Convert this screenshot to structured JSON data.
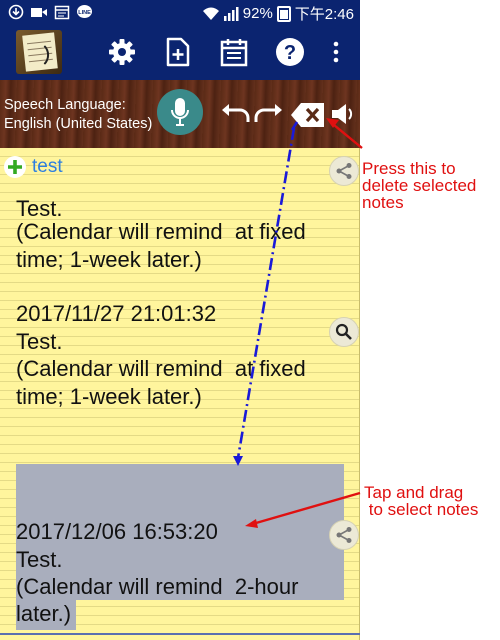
{
  "status_bar": {
    "battery": "92%",
    "time": "下午2:46",
    "icons": [
      "download-icon",
      "video-icon",
      "calendar-icon",
      "line-icon",
      "wifi-icon",
      "signal-icon",
      "battery-icon"
    ]
  },
  "toolbar": {
    "icons": [
      "app-logo",
      "gear-icon",
      "add-note-icon",
      "calendar-icon",
      "help-icon",
      "more-icon"
    ]
  },
  "speech": {
    "label": "Speech Language:",
    "language": "English (United States)"
  },
  "note": {
    "title": "test",
    "blocks": [
      {
        "lines": [
          "Test.",
          "(Calendar will remind  at fixed",
          "time; 1-week later.)"
        ]
      },
      {
        "timestamp": "2017/11/27 21:01:32",
        "lines": [
          "Test.",
          "(Calendar will remind  at fixed",
          "time; 1-week later.)"
        ]
      },
      {
        "timestamp": "2017/12/06 16:53:20",
        "lines": [
          "Test.",
          "(Calendar will remind  2-hour",
          "later.)"
        ]
      }
    ]
  },
  "annotations": {
    "delete_hint": "Press this to\ndelete selected\nnotes",
    "drag_hint": "Tap and drag\n to select notes"
  },
  "colors": {
    "toolbar": "#0b2470",
    "paper": "#fff59d",
    "selection": "#a9aebd",
    "annotation": "#e01010",
    "title": "#2d7fe0"
  }
}
